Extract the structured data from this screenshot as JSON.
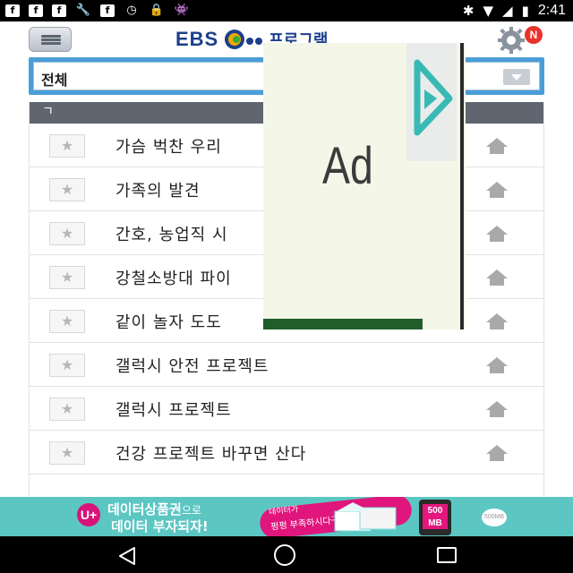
{
  "status_bar": {
    "time": "2:41",
    "left_icons": [
      "facebook-icon",
      "facebook-icon",
      "facebook-icon",
      "wrench-icon",
      "facebook-icon",
      "clock-icon",
      "lock-icon",
      "android-icon"
    ],
    "right_icons": [
      "bluetooth-icon",
      "wifi-icon",
      "no-signal-icon",
      "battery-icon"
    ]
  },
  "header": {
    "logo_text": "EBS",
    "logo_suffix": "프로그램",
    "notification_badge": "N"
  },
  "filter": {
    "selected": "전체"
  },
  "list": {
    "section_header": "ㄱ",
    "items": [
      {
        "title": "가슴 벅찬 우리"
      },
      {
        "title": "가족의 발견"
      },
      {
        "title": "간호, 농업직 시"
      },
      {
        "title": "강철소방대 파이"
      },
      {
        "title": "같이 놀자 도도"
      },
      {
        "title": "갤럭시 안전 프로젝트"
      },
      {
        "title": "갤럭시 프로젝트"
      },
      {
        "title": "건강 프로젝트 바꾸면 산다"
      }
    ]
  },
  "ad": {
    "label": "Ad"
  },
  "banner": {
    "logo": "U+",
    "line1_main": "데이터상품권",
    "line1_suffix": "으로",
    "line2": "데이터 부자되자!",
    "badge_line1": "데이터가",
    "badge_line2": "펑펑 부족하시다구요?",
    "phone_text": "500\nMB",
    "coin_text": "500MB"
  },
  "colors": {
    "brand_blue": "#1c3f8c",
    "filter_blue": "#4a9ed8",
    "section_gray": "#5f6670",
    "badge_red": "#e8332c",
    "banner_teal": "#5cc6c2",
    "banner_pink": "#e0167c"
  }
}
